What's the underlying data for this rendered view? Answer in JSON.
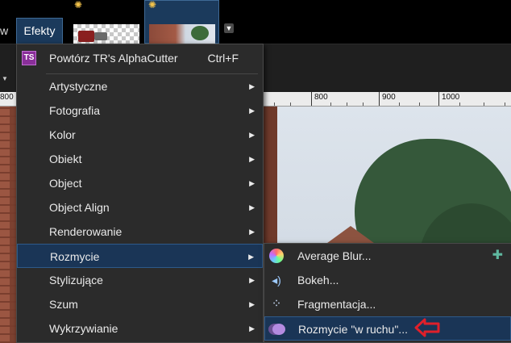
{
  "menubar": {
    "partial_menu": "w",
    "effects_menu": "Efekty"
  },
  "ruler": {
    "ticks": [
      "800",
      "800",
      "900",
      "1000"
    ]
  },
  "effects_menu": {
    "repeat": {
      "label": "Powtórz TR's AlphaCutter",
      "shortcut": "Ctrl+F",
      "icon": "tr-plugin-icon"
    },
    "items": [
      {
        "label": "Artystyczne"
      },
      {
        "label": "Fotografia"
      },
      {
        "label": "Kolor"
      },
      {
        "label": "Obiekt"
      },
      {
        "label": "Object"
      },
      {
        "label": "Object Align"
      },
      {
        "label": "Renderowanie"
      },
      {
        "label": "Rozmycie"
      },
      {
        "label": "Stylizujące"
      },
      {
        "label": "Szum"
      },
      {
        "label": "Wykrzywianie"
      }
    ],
    "highlighted": "Rozmycie"
  },
  "blur_submenu": {
    "items": [
      {
        "label": "Average Blur...",
        "icon": "color-wheel-icon"
      },
      {
        "label": "Bokeh...",
        "icon": "bokeh-icon"
      },
      {
        "label": "Fragmentacja...",
        "icon": "fragment-icon"
      },
      {
        "label": "Rozmycie \"w ruchu\"...",
        "icon": "motion-blur-icon"
      }
    ],
    "highlighted": "Rozmycie \"w ruchu\"..."
  },
  "colors": {
    "highlight": "#1a3556",
    "menu_bg": "#2b2b2b",
    "annotation_arrow": "#e0202a"
  }
}
